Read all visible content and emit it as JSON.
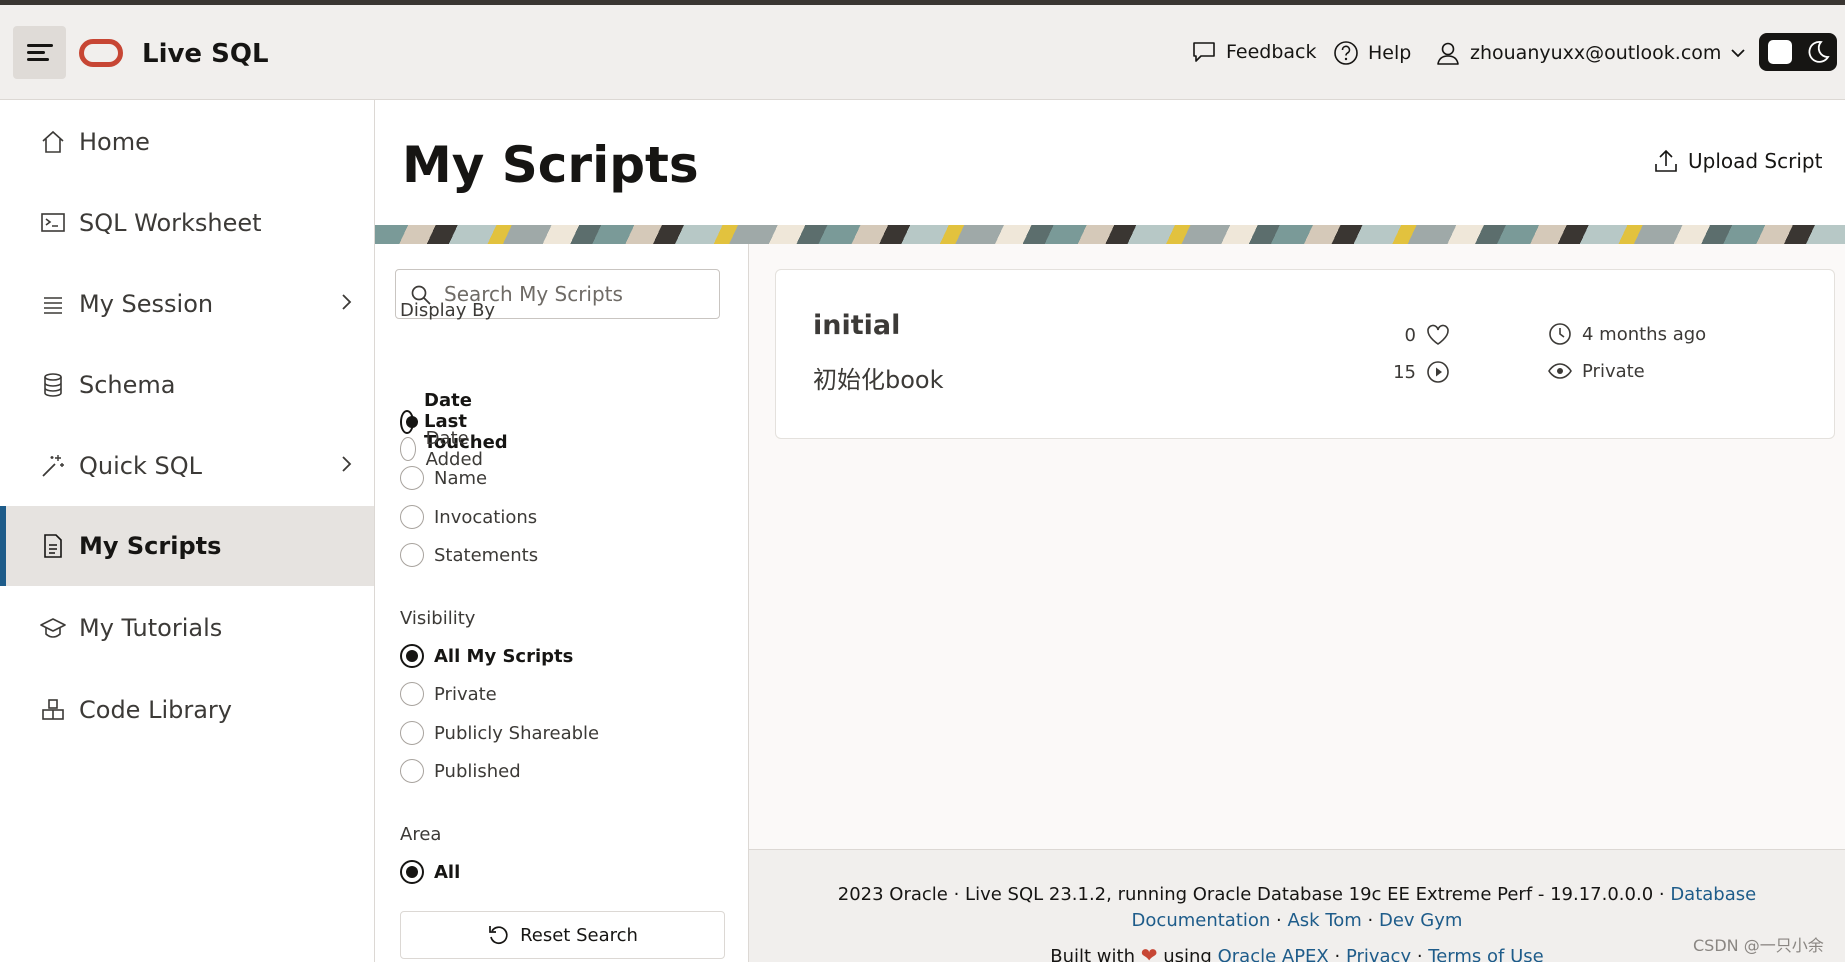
{
  "header": {
    "app_title": "Live SQL",
    "feedback_label": "Feedback",
    "help_label": "Help",
    "user_email": "zhouanyuxx@outlook.com"
  },
  "sidebar": {
    "items": [
      {
        "label": "Home",
        "icon": "home-icon"
      },
      {
        "label": "SQL Worksheet",
        "icon": "terminal-icon"
      },
      {
        "label": "My Session",
        "icon": "list-icon"
      },
      {
        "label": "Schema",
        "icon": "database-icon"
      },
      {
        "label": "Quick SQL",
        "icon": "magic-wand-icon"
      },
      {
        "label": "My Scripts",
        "icon": "document-icon",
        "active": true
      },
      {
        "label": "My Tutorials",
        "icon": "graduation-cap-icon"
      },
      {
        "label": "Code Library",
        "icon": "library-icon"
      }
    ]
  },
  "main": {
    "page_title": "My Scripts",
    "upload_label": "Upload Script"
  },
  "filters": {
    "search_placeholder": "Search My Scripts",
    "display_by": {
      "label": "Display By",
      "options": [
        "Date Last Touched",
        "Date Added",
        "Name",
        "Invocations",
        "Statements"
      ],
      "selected": "Date Last Touched"
    },
    "visibility": {
      "label": "Visibility",
      "options": [
        "All My Scripts",
        "Private",
        "Publicly Shareable",
        "Published"
      ],
      "selected": "All My Scripts"
    },
    "area": {
      "label": "Area",
      "options": [
        "All"
      ],
      "selected": "All"
    },
    "reset_label": "Reset Search"
  },
  "results": [
    {
      "title": "initial",
      "description": "初始化book",
      "likes": "0",
      "runs": "15",
      "updated": "4 months ago",
      "visibility": "Private"
    }
  ],
  "footer": {
    "line1_prefix": "2023 Oracle · Live SQL 23.1.2, running Oracle Database 19c EE Extreme Perf - 19.17.0.0.0 · ",
    "link_docs": "Database Documentation",
    "sep1": " · ",
    "link_asktom": "Ask Tom",
    "sep2": " · ",
    "link_devgym": "Dev Gym",
    "built_with": "Built with",
    "using": "using",
    "link_apex": "Oracle APEX",
    "sep3": " · ",
    "link_privacy": "Privacy",
    "sep4": " · ",
    "link_terms": "Terms of Use"
  },
  "watermark": "CSDN @一只小余",
  "colors": {
    "accent": "#1e5c8a",
    "brand": "#c74634",
    "header_bg": "#f1efed"
  }
}
